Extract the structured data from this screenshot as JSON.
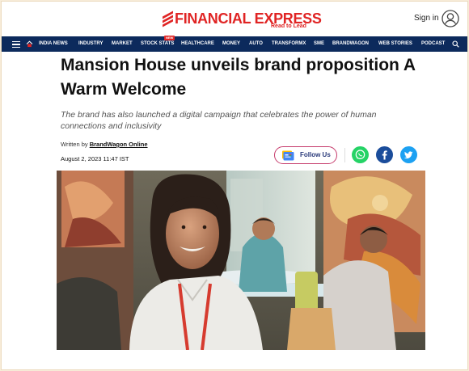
{
  "header": {
    "brand_name": "FINANCIAL EXPRESS",
    "brand_tagline": "Read to Lead",
    "signin_label": "Sign in",
    "brand_color": "#e02424"
  },
  "nav": {
    "background_color": "#0c2a5c",
    "new_badge": "NEW",
    "items": [
      {
        "label": "INDIA NEWS"
      },
      {
        "label": "INDUSTRY"
      },
      {
        "label": "MARKET"
      },
      {
        "label": "STOCK STATS"
      },
      {
        "label": "HEALTHCARE"
      },
      {
        "label": "MONEY"
      },
      {
        "label": "AUTO"
      },
      {
        "label": "TRANSFORMX"
      },
      {
        "label": "SME"
      },
      {
        "label": "BRANDWAGON"
      },
      {
        "label": "WEB STORIES"
      },
      {
        "label": "PODCAST"
      }
    ]
  },
  "article": {
    "title": "Mansion House unveils brand proposition A Warm Welcome",
    "subtitle": "The brand has also launched a digital campaign that celebrates the power of human connections and inclusivity",
    "byline_prefix": "Written by",
    "author": "BrandWagon Online",
    "date": "August 2, 2023 11:47 IST"
  },
  "share": {
    "follow_label": "Follow Us",
    "icons": [
      "google-news-icon",
      "whatsapp-icon",
      "facebook-icon",
      "twitter-icon"
    ]
  }
}
